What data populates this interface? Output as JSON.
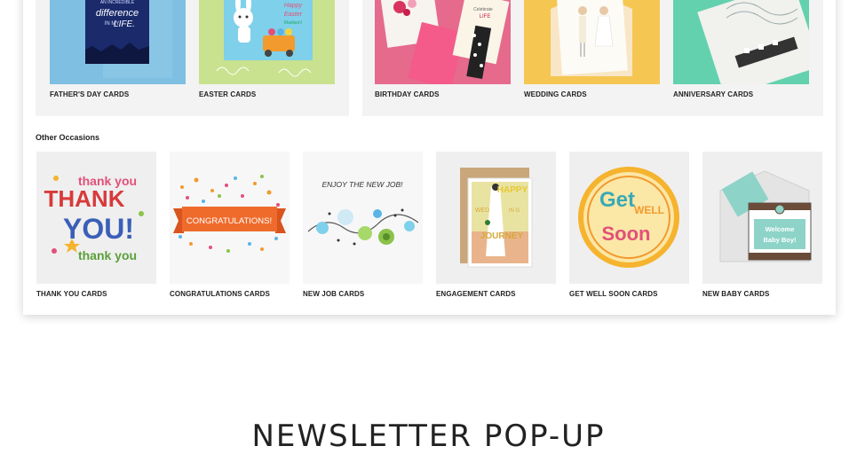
{
  "top_row": {
    "group_a": [
      {
        "label": "FATHER'S DAY CARDS",
        "card_text": [
          "AN INCREDIBLE",
          "difference",
          "IN MY",
          "LIFE."
        ]
      },
      {
        "label": "EASTER CARDS",
        "card_text": [
          "Happy",
          "Easter",
          "Madison!"
        ]
      }
    ],
    "group_b": [
      {
        "label": "BIRTHDAY CARDS",
        "card_text": [
          "Celebrate",
          "LIFE"
        ]
      },
      {
        "label": "WEDDING CARDS"
      },
      {
        "label": "ANNIVERSARY CARDS"
      }
    ]
  },
  "other_occasions": {
    "title": "Other Occasions",
    "cards": [
      {
        "label": "THANK YOU CARDS",
        "card_text": [
          "thank you",
          "THANK",
          "YOU!",
          "thank you"
        ]
      },
      {
        "label": "CONGRATULATIONS CARDS",
        "card_text": [
          "CONGRATULATIONS!"
        ]
      },
      {
        "label": "NEW JOB CARDS",
        "card_text": [
          "ENJOY THE NEW JOB!"
        ]
      },
      {
        "label": "ENGAGEMENT CARDS",
        "card_text": [
          "HAPPY",
          "WED",
          "IN G",
          "JOURNEY"
        ]
      },
      {
        "label": "GET WELL SOON CARDS",
        "card_text": [
          "Get",
          "WELL",
          "Soon"
        ]
      },
      {
        "label": "NEW BABY CARDS",
        "card_text": [
          "Welcome",
          "Baby Boy!"
        ]
      }
    ]
  },
  "newsletter": {
    "heading": "NEWSLETTER POP-UP"
  },
  "colors": {
    "panel_bg": "#ffffff",
    "group_bg": "#f3f3f3",
    "tile_bg": "#efefef",
    "text": "#222222"
  }
}
